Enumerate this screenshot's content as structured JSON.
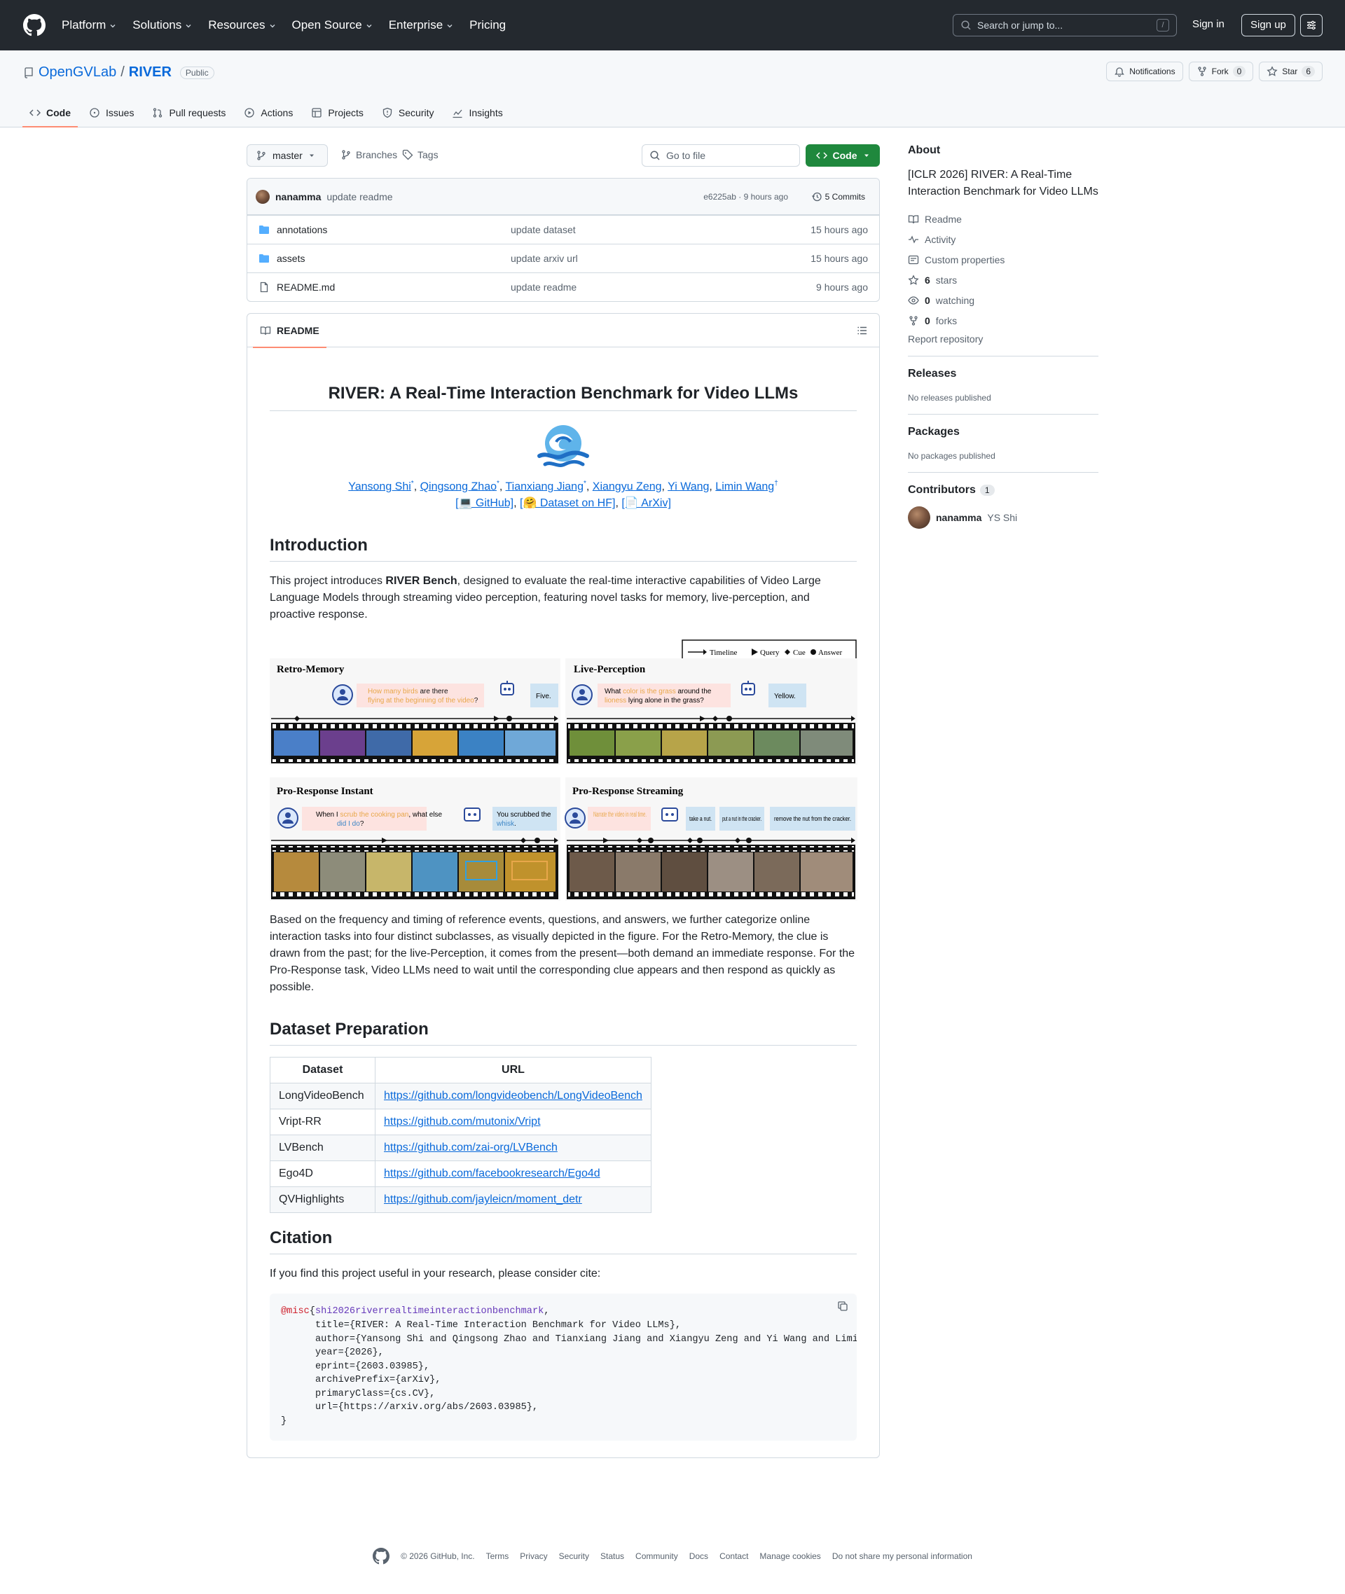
{
  "header": {
    "nav": [
      "Platform",
      "Solutions",
      "Resources",
      "Open Source",
      "Enterprise",
      "Pricing"
    ],
    "search_placeholder": "Search or jump to...",
    "search_kbd": "/",
    "sign_in": "Sign in",
    "sign_up": "Sign up"
  },
  "repo": {
    "owner": "OpenGVLab",
    "separator": "/",
    "name": "RIVER",
    "visibility": "Public",
    "notifications": "Notifications",
    "fork_label": "Fork",
    "fork_count": "0",
    "star_label": "Star",
    "star_count": "6",
    "tabs": [
      "Code",
      "Issues",
      "Pull requests",
      "Actions",
      "Projects",
      "Security",
      "Insights"
    ]
  },
  "toolbar": {
    "branch": "master",
    "branches": "Branches",
    "tags": "Tags",
    "goto_placeholder": "Go to file",
    "code_button": "Code"
  },
  "commit": {
    "author": "nanamma",
    "message": "update readme",
    "hash_time": "e6225ab · 9 hours ago",
    "commits": "5 Commits"
  },
  "files": [
    {
      "name": "annotations",
      "type": "dir",
      "message": "update dataset",
      "time": "15 hours ago"
    },
    {
      "name": "assets",
      "type": "dir",
      "message": "update arxiv url",
      "time": "15 hours ago"
    },
    {
      "name": "README.md",
      "type": "file",
      "message": "update readme",
      "time": "9 hours ago"
    }
  ],
  "readme": {
    "tab": "README",
    "title": "RIVER: A Real-Time Interaction Benchmark for Video LLMs",
    "authors": [
      {
        "name": "Yansong Shi",
        "mark": "*"
      },
      {
        "name": "Qingsong Zhao",
        "mark": "*"
      },
      {
        "name": "Tianxiang Jiang",
        "mark": "*"
      },
      {
        "name": "Xiangyu Zeng",
        "mark": ""
      },
      {
        "name": "Yi Wang",
        "mark": ""
      },
      {
        "name": "Limin Wang",
        "mark": "†"
      }
    ],
    "links": [
      "[💻 GitHub]",
      "[🤗 Dataset on HF]",
      "[📄 ArXiv]"
    ],
    "intro_heading": "Introduction",
    "intro_pre": "This project introduces ",
    "intro_bold": "RIVER Bench",
    "intro_post": ", designed to evaluate the real-time interactive capabilities of Video Large Language Models through streaming video perception, featuring novel tasks for memory, live-perception, and proactive response.",
    "figure": {
      "legend": [
        "Timeline",
        "Query",
        "Cue",
        "Answer"
      ],
      "panels": [
        {
          "title": "Retro-Memory",
          "q_pre": "How many birds",
          "q_mid": " are there ",
          "q_hi": "flying at the beginning of the video",
          "q_end": "?",
          "answer": "Five."
        },
        {
          "title": "Live-Perception",
          "q_pre": "What ",
          "q_hi": "color is the grass",
          "q_mid": " around the ",
          "q_hi2": "lioness",
          "q_end": " lying alone in the grass?",
          "answer": "Yellow."
        },
        {
          "title": "Pro-Response Instant",
          "q_pre": "When I ",
          "q_hi": "scrub the cooking pan",
          "q_mid": ", what else ",
          "q_hi2": "did I do",
          "q_end": "?",
          "answer_pre": "You scrubbed the ",
          "answer_hi": "whisk",
          "answer_end": "."
        },
        {
          "title": "Pro-Response Streaming",
          "q_hi": "Narrate the video in real time.",
          "answers": [
            "take a nut.",
            "put a nut in the cracker.",
            "remove the nut from the cracker."
          ]
        }
      ]
    },
    "paragraph2": "Based on the frequency and timing of reference events, questions, and answers, we further categorize online interaction tasks into four distinct subclasses, as visually depicted in the figure. For the Retro-Memory, the clue is drawn from the past; for the live-Perception, it comes from the present—both demand an immediate response. For the Pro-Response task, Video LLMs need to wait until the corresponding clue appears and then respond as quickly as possible.",
    "dataset_heading": "Dataset Preparation",
    "table_headers": [
      "Dataset",
      "URL"
    ],
    "table_rows": [
      [
        "LongVideoBench",
        "https://github.com/longvideobench/LongVideoBench"
      ],
      [
        "Vript-RR",
        "https://github.com/mutonix/Vript"
      ],
      [
        "LVBench",
        "https://github.com/zai-org/LVBench"
      ],
      [
        "Ego4D",
        "https://github.com/facebookresearch/Ego4d"
      ],
      [
        "QVHighlights",
        "https://github.com/jayleicn/moment_detr"
      ]
    ],
    "citation_heading": "Citation",
    "citation_text": "If you find this project useful in your research, please consider cite:",
    "bibtex": {
      "type": "@misc",
      "key": "shi2026riverrealtimeinteractionbenchmark",
      "lines": [
        "      title={RIVER: A Real-Time Interaction Benchmark for Video LLMs},",
        "      author={Yansong Shi and Qingsong Zhao and Tianxiang Jiang and Xiangyu Zeng and Yi Wang and Limin Wang},",
        "      year={2026},",
        "      eprint={2603.03985},",
        "      archivePrefix={arXiv},",
        "      primaryClass={cs.CV},",
        "      url={https://arxiv.org/abs/2603.03985},",
        "}"
      ]
    }
  },
  "sidebar": {
    "about_heading": "About",
    "description": "[ICLR 2026] RIVER: A Real-Time Interaction Benchmark for Video LLMs",
    "links": [
      {
        "icon": "book-icon",
        "label": "Readme",
        "count": ""
      },
      {
        "icon": "pulse-icon",
        "label": "Activity",
        "count": ""
      },
      {
        "icon": "note-icon",
        "label": "Custom properties",
        "count": ""
      },
      {
        "icon": "star-icon",
        "label": "stars",
        "count": "6"
      },
      {
        "icon": "eye-icon",
        "label": "watching",
        "count": "0"
      },
      {
        "icon": "fork-icon",
        "label": "forks",
        "count": "0"
      }
    ],
    "report": "Report repository",
    "releases_heading": "Releases",
    "releases_text": "No releases published",
    "packages_heading": "Packages",
    "packages_text": "No packages published",
    "contributors_heading": "Contributors",
    "contributors_count": "1",
    "contributor_login": "nanamma",
    "contributor_name": "YS Shi"
  },
  "footer": {
    "copyright": "© 2026 GitHub, Inc.",
    "links": [
      "Terms",
      "Privacy",
      "Security",
      "Status",
      "Community",
      "Docs",
      "Contact",
      "Manage cookies",
      "Do not share my personal information"
    ]
  },
  "colors": {
    "header_bg": "#24292f",
    "link": "#0969da",
    "primary_button": "#1f883d",
    "tab_underline": "#fd8c73",
    "bib_keyword": "#cf222e",
    "bib_key": "#6639ba"
  }
}
